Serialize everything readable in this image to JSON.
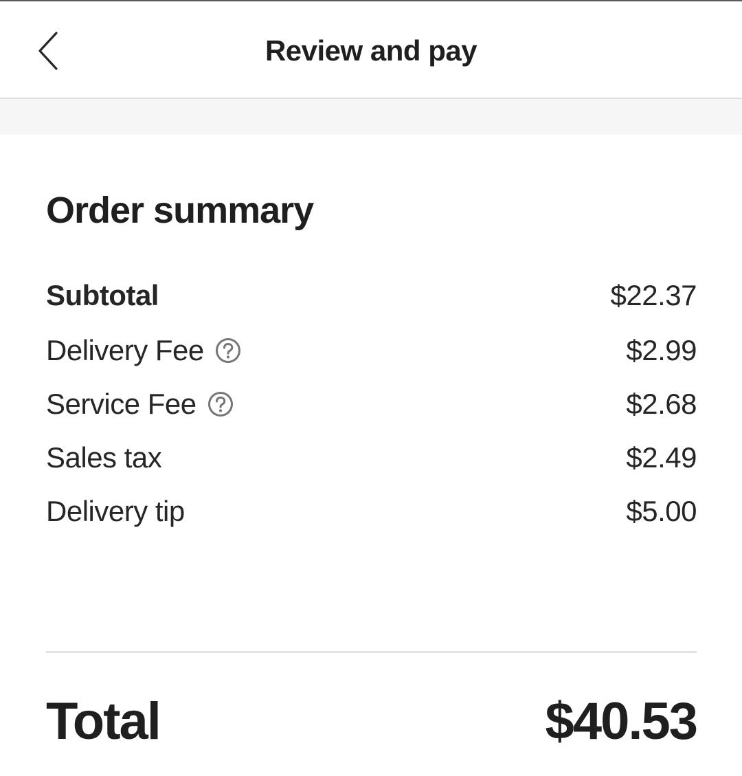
{
  "header": {
    "title": "Review and pay",
    "back_icon": "chevron-left-icon"
  },
  "order_summary": {
    "title": "Order summary",
    "items": [
      {
        "label": "Subtotal",
        "value": "$22.37",
        "bold": true,
        "help": false
      },
      {
        "label": "Delivery Fee",
        "value": "$2.99",
        "bold": false,
        "help": true
      },
      {
        "label": "Service Fee",
        "value": "$2.68",
        "bold": false,
        "help": true
      },
      {
        "label": "Sales tax",
        "value": "$2.49",
        "bold": false,
        "help": false
      },
      {
        "label": "Delivery tip",
        "value": "$5.00",
        "bold": false,
        "help": false
      }
    ],
    "total_label": "Total",
    "total_value": "$40.53"
  },
  "colors": {
    "text": "#262626",
    "divider": "#e3e3e3",
    "band": "#f6f6f6",
    "icon": "#767676"
  }
}
